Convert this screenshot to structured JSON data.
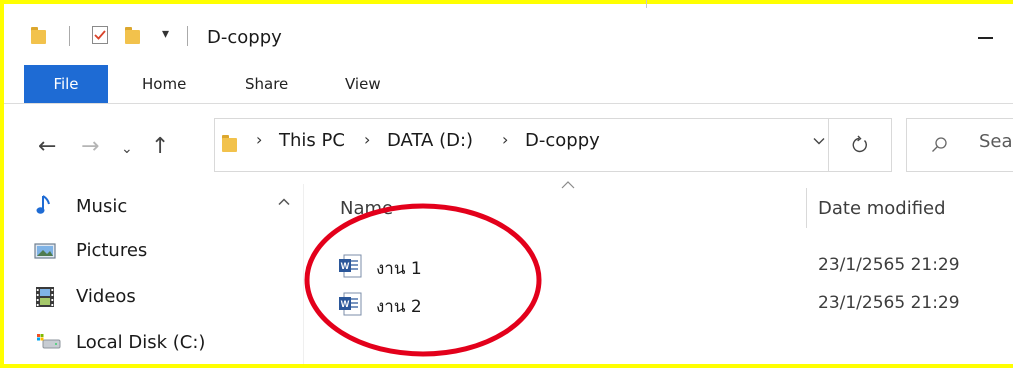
{
  "window": {
    "title": "D-coppy"
  },
  "ribbon": {
    "tabs": [
      "File",
      "Home",
      "Share",
      "View"
    ]
  },
  "address": {
    "breadcrumbs": [
      "This PC",
      "DATA (D:)",
      "D-coppy"
    ],
    "search_placeholder": "Sea"
  },
  "nav_pane": {
    "items": [
      {
        "label": "Music",
        "icon": "music-note-icon"
      },
      {
        "label": "Pictures",
        "icon": "pictures-icon"
      },
      {
        "label": "Videos",
        "icon": "videos-icon"
      },
      {
        "label": "Local Disk (C:)",
        "icon": "drive-icon"
      }
    ]
  },
  "file_list": {
    "columns": [
      "Name",
      "Date modified"
    ],
    "rows": [
      {
        "name": "งาน 1",
        "date": "23/1/2565 21:29",
        "icon": "word-document-icon"
      },
      {
        "name": "งาน 2",
        "date": "23/1/2565 21:29",
        "icon": "word-document-icon"
      }
    ]
  },
  "colors": {
    "file_tab": "#1e6bd4",
    "highlight_border": "#ffff00",
    "annotation": "#e3001b"
  }
}
